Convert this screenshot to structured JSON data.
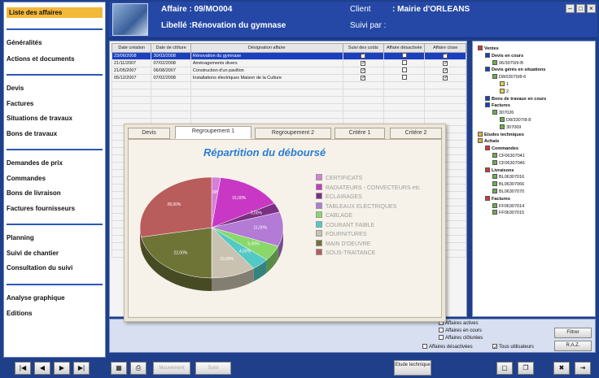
{
  "sidebar": {
    "items": [
      {
        "label": "Liste des affaires",
        "active": true
      },
      {
        "label": "Généralités"
      },
      {
        "label": "Actions et documents"
      },
      {
        "label": "Devis"
      },
      {
        "label": "Factures"
      },
      {
        "label": "Situations de travaux"
      },
      {
        "label": "Bons de travaux"
      },
      {
        "label": "Demandes de prix"
      },
      {
        "label": "Commandes"
      },
      {
        "label": "Bons de livraison"
      },
      {
        "label": "Factures fournisseurs"
      },
      {
        "label": "Planning"
      },
      {
        "label": "Suivi de chantier"
      },
      {
        "label": "Consultation du suivi"
      },
      {
        "label": "Analyse graphique"
      },
      {
        "label": "Editions"
      }
    ]
  },
  "header": {
    "affaire_label": "Affaire : 09/MO004",
    "libelle_label": "Libellé :Rénovation du gymnase",
    "client_label": "Client",
    "client_value": ": Mairie d'ORLEANS",
    "suivi_label": "Suivi par :"
  },
  "grid": {
    "columns": [
      "Date création",
      "Date de clôture",
      "Désignation affaire",
      "Suivi des coûts",
      "Affaire désactivée",
      "Affaire close"
    ],
    "rows": [
      {
        "date_creation": "23/06/2008",
        "date_cloture": "30/03/2008",
        "designation": "Rénovation du gymnase",
        "suivi": true,
        "desactivee": false,
        "close": true
      },
      {
        "date_creation": "21/11/2007",
        "date_cloture": "07/02/2008",
        "designation": "Aménagements divers",
        "suivi": true,
        "desactivee": false,
        "close": true
      },
      {
        "date_creation": "21/05/2007",
        "date_cloture": "06/08/2007",
        "designation": "Construction d'un pavillon",
        "suivi": true,
        "desactivee": false,
        "close": true
      },
      {
        "date_creation": "05/12/2007",
        "date_cloture": "07/02/2008",
        "designation": "Installations électriques Maison de la Culture",
        "suivi": true,
        "desactivee": false,
        "close": true
      }
    ]
  },
  "dialog": {
    "tabs": [
      "Devis",
      "Regroupement 1",
      "Regroupement 2",
      "Critère 1",
      "Critère 2"
    ],
    "active_tab": 1
  },
  "chart_data": {
    "type": "pie",
    "title": "Répartition du déboursé",
    "series": [
      {
        "name": "CERTIFICATS",
        "value": 2,
        "color": "#d47fd8",
        "label": "2,00%"
      },
      {
        "name": "RADIATEURS - CONVECTEURS etc",
        "value": 15,
        "color": "#c938c4",
        "label": "15,00%"
      },
      {
        "name": "ECLAIRAGES",
        "value": 3,
        "color": "#7a2f83",
        "label": "3,00%"
      },
      {
        "name": "TABLEAUX ELECTRIQUES",
        "value": 11,
        "color": "#b37ad6",
        "label": "11,00%"
      },
      {
        "name": "CABLAGE",
        "value": 5,
        "color": "#8ad86a",
        "label": "5,00%"
      },
      {
        "name": "COURANT FAIBLE",
        "value": 4,
        "color": "#52c9c4",
        "label": "4,00%"
      },
      {
        "name": "FOURNITURES",
        "value": 10,
        "color": "#c9c2b0",
        "label": "10,00%"
      },
      {
        "name": "MAIN D'OEUVRE",
        "value": 22,
        "color": "#6d7436",
        "label": "22,00%"
      },
      {
        "name": "SOUS-TRAITANCE",
        "value": 28,
        "color": "#b95c5c",
        "label": "28,00%"
      }
    ]
  },
  "tree": {
    "nodes": [
      {
        "label": "Ventes",
        "depth": 0,
        "color": "#d33"
      },
      {
        "label": "Devis en cours",
        "depth": 1,
        "color": "#1a3fc0"
      },
      {
        "label": "06/3070/9-B",
        "depth": 2,
        "color": "#6ab04c"
      },
      {
        "label": "Devis gérés en situations",
        "depth": 1,
        "color": "#1a3fc0"
      },
      {
        "label": "D8/03070/8-6",
        "depth": 2,
        "color": "#6ab04c"
      },
      {
        "label": "1",
        "depth": 3,
        "color": "#e6d04a"
      },
      {
        "label": "2",
        "depth": 3,
        "color": "#e6d04a"
      },
      {
        "label": "Bons de travaux en cours",
        "depth": 1,
        "color": "#1a3fc0"
      },
      {
        "label": "Factures",
        "depth": 1,
        "color": "#1a3fc0"
      },
      {
        "label": "307026",
        "depth": 2,
        "color": "#6ab04c"
      },
      {
        "label": "D8/3307/8-8",
        "depth": 3,
        "color": "#6ab04c"
      },
      {
        "label": "307069",
        "depth": 3,
        "color": "#6ab04c"
      },
      {
        "label": "Etudes techniques",
        "depth": 0,
        "color": "#e6b43a"
      },
      {
        "label": "Achats",
        "depth": 0,
        "color": "#e6b43a"
      },
      {
        "label": "Commandes",
        "depth": 1,
        "color": "#d33"
      },
      {
        "label": "CF06307041",
        "depth": 2,
        "color": "#6ab04c"
      },
      {
        "label": "CF06307046",
        "depth": 2,
        "color": "#6ab04c"
      },
      {
        "label": "Livraisons",
        "depth": 1,
        "color": "#d33"
      },
      {
        "label": "BL06307016",
        "depth": 2,
        "color": "#6ab04c"
      },
      {
        "label": "BL06307066",
        "depth": 2,
        "color": "#6ab04c"
      },
      {
        "label": "BL06307070",
        "depth": 2,
        "color": "#6ab04c"
      },
      {
        "label": "Factures",
        "depth": 1,
        "color": "#d33"
      },
      {
        "label": "FF06307014",
        "depth": 2,
        "color": "#6ab04c"
      },
      {
        "label": "FF06307015",
        "depth": 2,
        "color": "#6ab04c"
      }
    ]
  },
  "bottom": {
    "options": [
      "Affaires actives",
      "Affaires en cours",
      "Affaires clôturées",
      "Affaires désactivées",
      "Tous utilisateurs"
    ],
    "filter_button": "Filtrer",
    "raz_button": "R.A.Z.",
    "etude_button": "Etude technique",
    "mouvement_button": "Mouvement",
    "suivi_button": "Suivi"
  }
}
